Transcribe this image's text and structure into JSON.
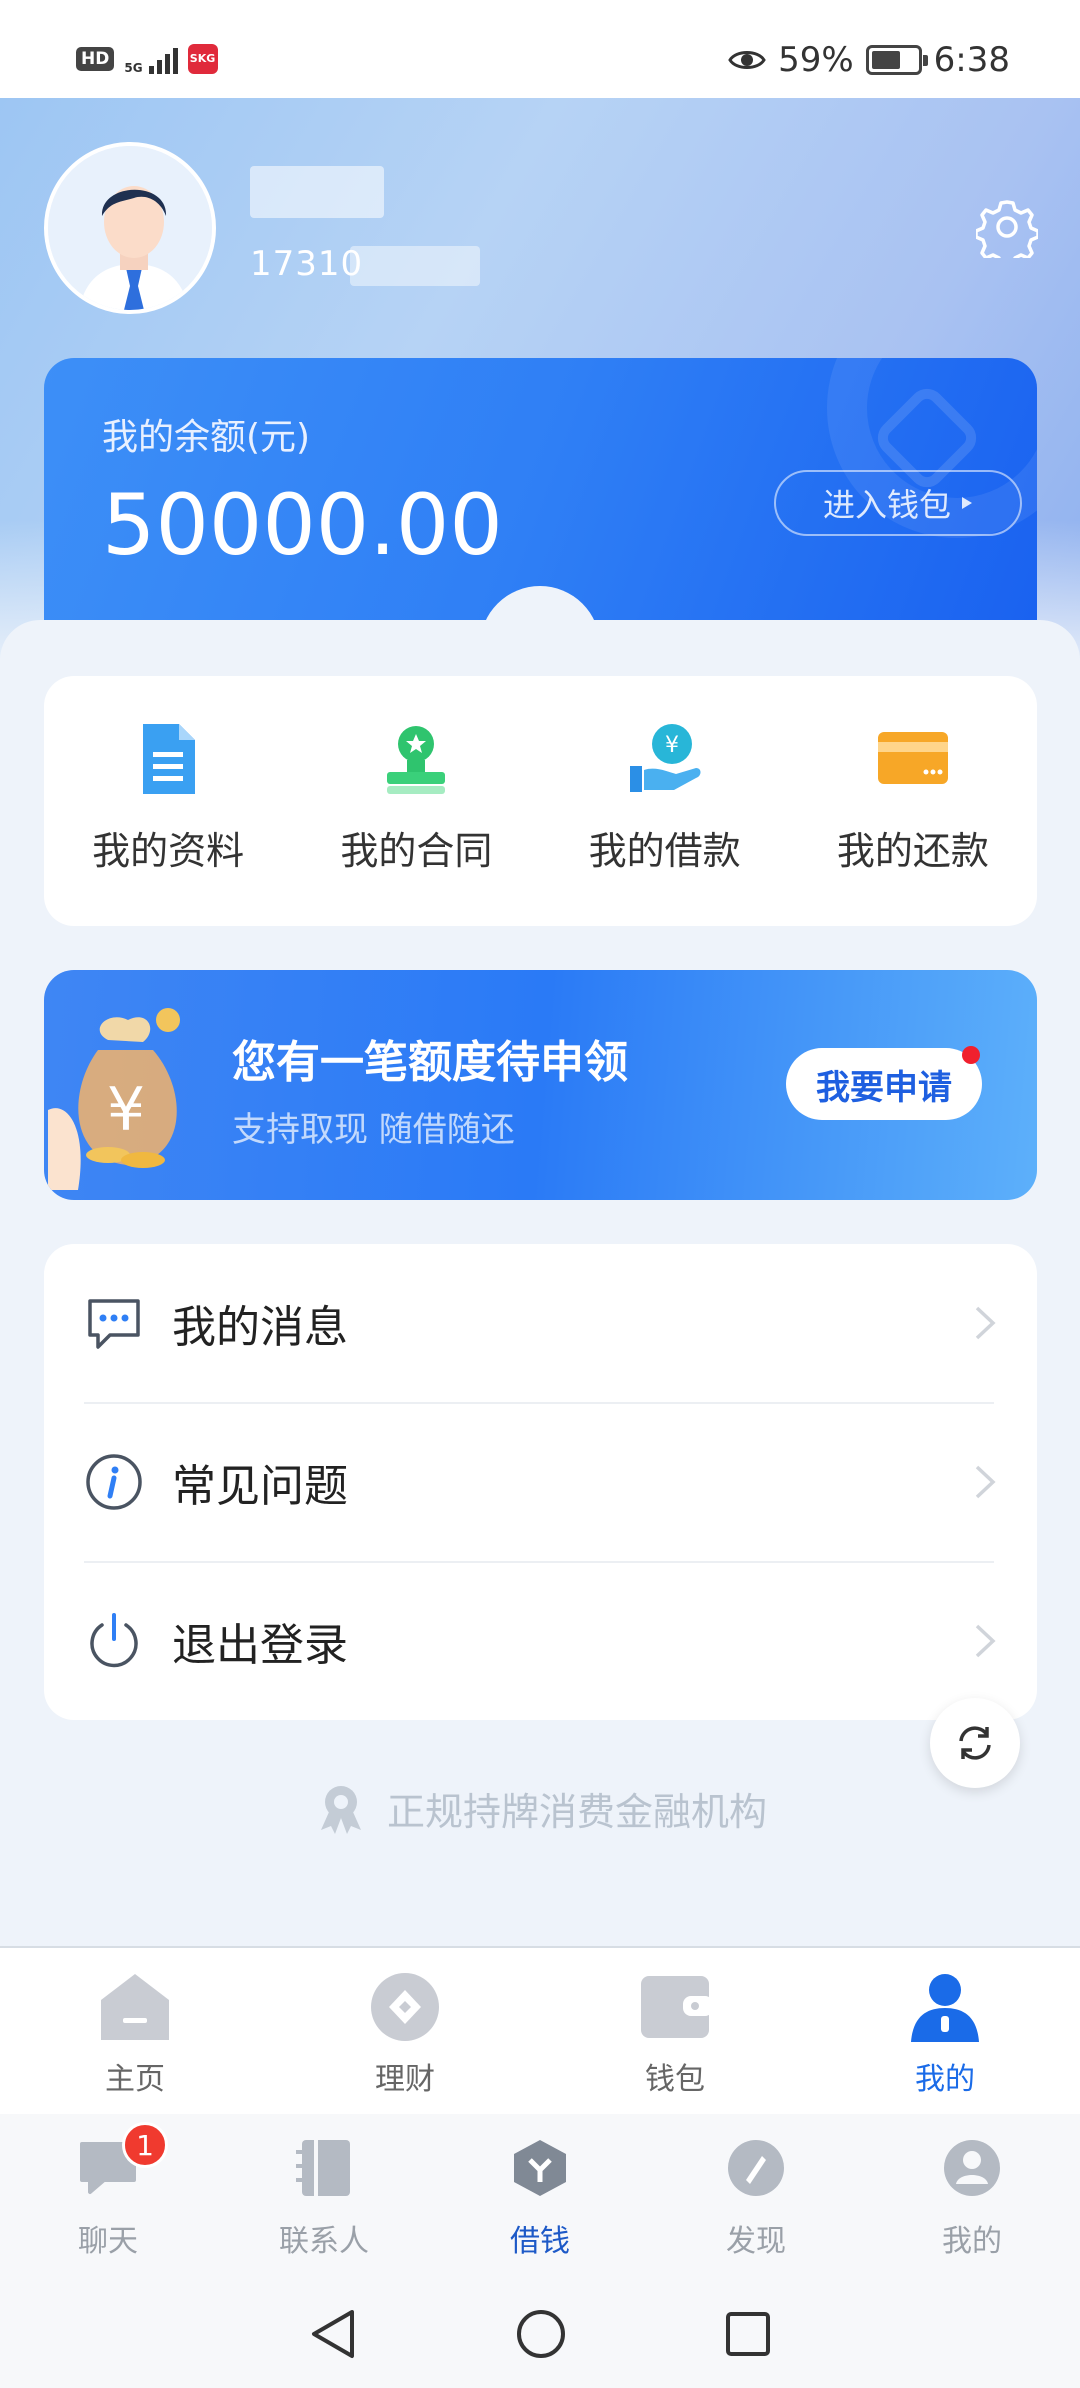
{
  "status_bar": {
    "left_badge": "HD",
    "network": "5G",
    "app_badge": "SKG",
    "battery_percent": "59%",
    "time": "6:38"
  },
  "profile": {
    "phone_visible": "17310"
  },
  "balance": {
    "label": "我的余额(元)",
    "value": "50000.00",
    "wallet_button": "进入钱包"
  },
  "quick_actions": [
    {
      "label": "我的资料",
      "icon": "document-icon",
      "color": "#3aa0f2"
    },
    {
      "label": "我的合同",
      "icon": "stamp-icon",
      "color": "#3ad07a"
    },
    {
      "label": "我的借款",
      "icon": "hand-coin-icon",
      "color": "#28b6d8"
    },
    {
      "label": "我的还款",
      "icon": "card-icon",
      "color": "#f7a727"
    }
  ],
  "banner": {
    "title": "您有一笔额度待申领",
    "subtitle": "支持取现 随借随还",
    "button": "我要申请"
  },
  "menu": [
    {
      "label": "我的消息",
      "icon": "message-icon"
    },
    {
      "label": "常见问题",
      "icon": "info-icon"
    },
    {
      "label": "退出登录",
      "icon": "power-icon"
    }
  ],
  "license_text": "正规持牌消费金融机构",
  "app_nav": [
    {
      "label": "主页",
      "icon": "home-icon"
    },
    {
      "label": "理财",
      "icon": "finance-icon"
    },
    {
      "label": "钱包",
      "icon": "wallet-icon"
    },
    {
      "label": "我的",
      "icon": "user-icon",
      "active": true
    }
  ],
  "host_nav": {
    "chat_badge": "1",
    "items": [
      {
        "label": "聊天",
        "icon": "chat-icon"
      },
      {
        "label": "联系人",
        "icon": "contacts-icon"
      },
      {
        "label": "借钱",
        "icon": "loan-icon",
        "active": true
      },
      {
        "label": "发现",
        "icon": "discover-icon"
      },
      {
        "label": "我的",
        "icon": "me-icon"
      }
    ]
  },
  "colors": {
    "accent": "#1a6be8",
    "balance_card": "#2f7ff5",
    "badge_red": "#f03a2f"
  }
}
